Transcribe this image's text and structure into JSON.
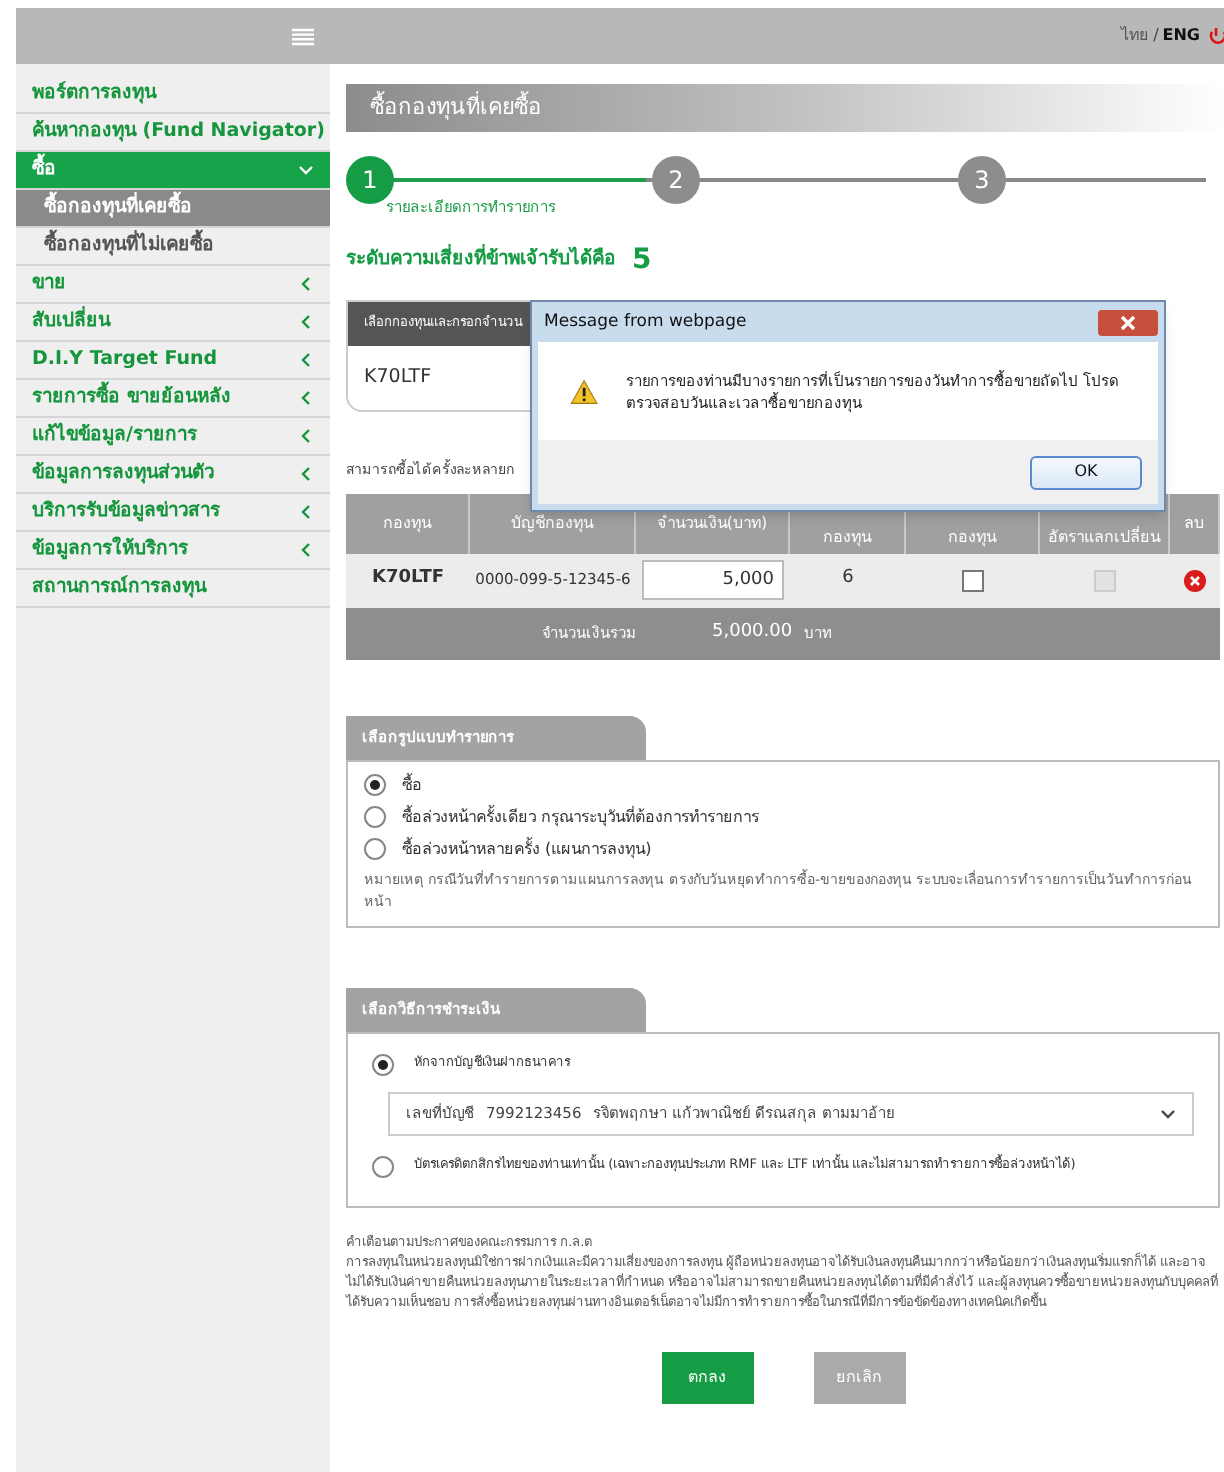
{
  "top_bar": {
    "languages": [
      {
        "label": "ไทย",
        "selected": false
      },
      {
        "label": "ENG",
        "selected": true
      }
    ],
    "separator": "/"
  },
  "sidebar": {
    "items": [
      {
        "label": "พอร์ตการลงทุน",
        "kind": "link",
        "selected": false
      },
      {
        "label": "ค้นหากองทุน (Fund Navigator)",
        "kind": "link",
        "selected": false
      },
      {
        "label": "ซื้อ",
        "kind": "submenu",
        "selected": true,
        "expanded": true,
        "children": [
          {
            "label": "ซื้อกองทุนที่เคยซื้อ",
            "selected": true
          },
          {
            "label": "ซื้อกองทุนที่ไม่เคยซื้อ",
            "selected": false
          }
        ]
      },
      {
        "label": "ขาย",
        "kind": "submenu",
        "selected": false,
        "expanded": false
      },
      {
        "label": "สับเปลี่ยน",
        "kind": "submenu",
        "selected": false,
        "expanded": false
      },
      {
        "label": "D.I.Y Target Fund",
        "kind": "submenu",
        "selected": false,
        "expanded": false
      },
      {
        "label": "รายการซื้อ ขายย้อนหลัง",
        "kind": "submenu",
        "selected": false,
        "expanded": false
      },
      {
        "label": "แก้ไขข้อมูล/รายการ",
        "kind": "submenu",
        "selected": false,
        "expanded": false
      },
      {
        "label": "ข้อมูลการลงทุนส่วนตัว",
        "kind": "submenu",
        "selected": false,
        "expanded": false
      },
      {
        "label": "บริการรับข้อมูลข่าวสาร",
        "kind": "submenu",
        "selected": false,
        "expanded": false
      },
      {
        "label": "ข้อมูลการให้บริการ",
        "kind": "submenu",
        "selected": false,
        "expanded": false
      },
      {
        "label": "สถานการณ์การลงทุน",
        "kind": "link",
        "selected": false
      }
    ]
  },
  "page_title": "ซื้อกองทุนที่เคยซื้อ",
  "steps": [
    {
      "number": "1",
      "label": "รายละเอียดการทำรายการ",
      "selected": true
    },
    {
      "number": "2",
      "selected": false
    },
    {
      "number": "3",
      "selected": false
    }
  ],
  "risk": {
    "label": "ระดับความเสี่ยงที่ข้าพเจ้ารับได้คือ",
    "value": "5"
  },
  "fund_panel": {
    "header": "เลือกกองทุนและกรอกจำนวน",
    "value": "K70LTF"
  },
  "multi_note": "สามารถซื้อได้ครั้งละหลายก",
  "table": {
    "columns": [
      "กองทุน",
      "บัญชีกองทุน",
      "จำนวนเงิน(บาท)",
      "กองทุน",
      "กองทุน",
      "อัตราแลกเปลี่ยน",
      "ลบ"
    ],
    "rows": [
      {
        "fund": "K70LTF",
        "account": "0000-099-5-12345-6",
        "amount": "5,000",
        "column_4": "6",
        "column_5_checked": false,
        "column_6_disabled": true
      }
    ],
    "total": {
      "label": "จำนวนเงินรวม",
      "value": "5,000.00",
      "unit": "บาท"
    }
  },
  "transaction_type": {
    "header": "เลือกรูปแบบทำรายการ",
    "options": [
      {
        "label": "ซื้อ",
        "selected": true
      },
      {
        "label": "ซื้อล่วงหน้าครั้งเดียว กรุณาระบุวันที่ต้องการทำรายการ",
        "selected": false
      },
      {
        "label": "ซื้อล่วงหน้าหลายครั้ง (แผนการลงทุน)",
        "selected": false
      }
    ],
    "note": "หมายเหตุ กรณีวันที่ทำรายการตามแผนการลงทุน ตรงกับวันหยุดทำการซื้อ-ขายของกองทุน ระบบจะเลื่อนการทำรายการเป็นวันทำการก่อนหน้า"
  },
  "payment": {
    "header": "เลือกวิธีการชำระเงิน",
    "options": [
      {
        "label": "หักจากบัญชีเงินฝากธนาคาร",
        "selected": true,
        "account": {
          "label": "เลขที่บัญชี",
          "number": "7992123456",
          "name": "รจิตพฤกษา แก้วพาณิชย์ ดีรณสกุล ตามมาอ้าย"
        }
      },
      {
        "label": "บัตรเครดิตกสิกรไทยของท่านเท่านั้น (เฉพาะกองทุนประเภท RMF และ LTF เท่านั้น และไม่สามารถทำรายการซื้อล่วงหน้าได้)",
        "selected": false
      }
    ]
  },
  "disclaimer": {
    "title": "คำเตือนตามประกาศของคณะกรรมการ ก.ล.ต",
    "text": "การลงทุนในหน่วยลงทุนมิใช่การฝากเงินและมีความเสี่ยงของการลงทุน ผู้ถือหน่วยลงทุนอาจได้รับเงินลงทุนคืนมากกว่าหรือน้อยกว่าเงินลงทุนเริ่มแรกก็ได้ และอาจไม่ได้รับเงินค่าขายคืนหน่วยลงทุนภายในระยะเวลาที่กำหนด หรืออาจไม่สามารถขายคืนหน่วยลงทุนได้ตามที่มีคำสั่งไว้ และผู้ลงทุนควรซื้อขายหน่วยลงทุนกับบุคคลที่ได้รับความเห็นชอบ การสั่งซื้อหน่วยลงทุนผ่านทางอินเตอร์เน็ตอาจไม่มีการทำรายการซื้อในกรณีที่มีการข้อขัดข้องทางเทคนิคเกิดขึ้น"
  },
  "buttons": [
    {
      "label": "ตกลง",
      "kind": "primary"
    },
    {
      "label": "ยกเลิก",
      "kind": "secondary"
    }
  ],
  "dialog": {
    "title": "Message from webpage",
    "message": "รายการของท่านมีบางรายการที่เป็นรายการของวันทำการซื้อขายถัดไป โปรดตรวจสอบวันและเวลาซื้อขายกองทุน",
    "button": "OK"
  }
}
